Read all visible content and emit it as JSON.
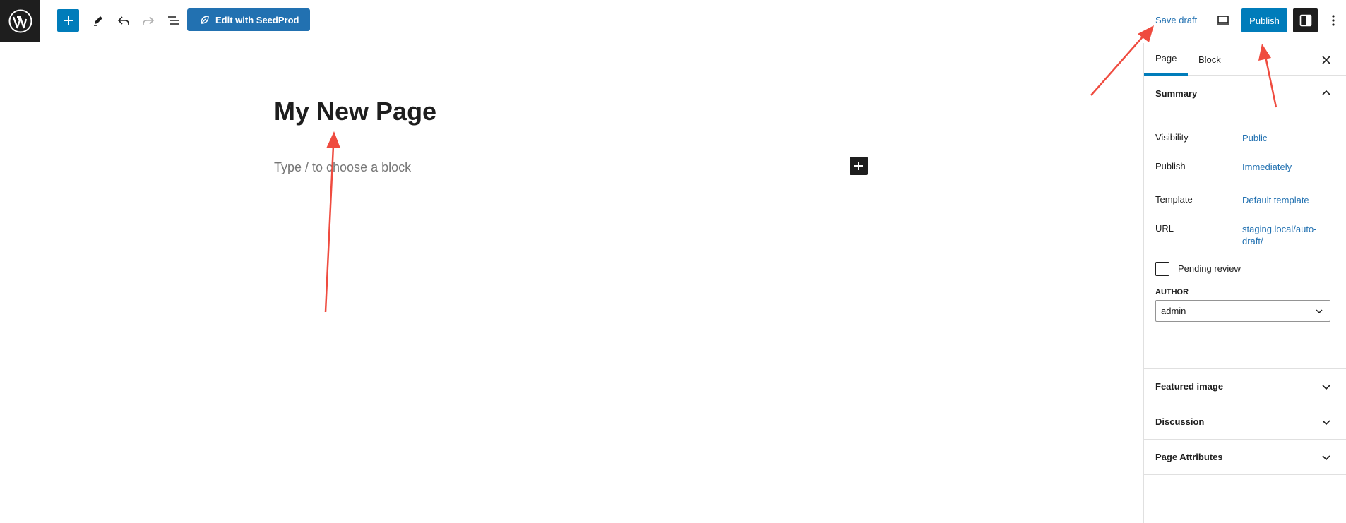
{
  "toolbar": {
    "seedprod_label": "Edit with SeedProd",
    "save_draft_label": "Save draft",
    "publish_label": "Publish"
  },
  "editor": {
    "title": "My New Page",
    "placeholder": "Type / to choose a block"
  },
  "sidebar": {
    "tabs": [
      {
        "label": "Page",
        "active": true
      },
      {
        "label": "Block",
        "active": false
      }
    ],
    "summary": {
      "heading": "Summary",
      "rows": [
        {
          "label": "Visibility",
          "value": "Public"
        },
        {
          "label": "Publish",
          "value": "Immediately"
        },
        {
          "label": "Template",
          "value": "Default template"
        },
        {
          "label": "URL",
          "value": "staging.local/auto-draft/"
        }
      ],
      "pending_review_label": "Pending review",
      "pending_review_checked": false,
      "author_label": "AUTHOR",
      "author_value": "admin"
    },
    "panels": [
      {
        "heading": "Featured image"
      },
      {
        "heading": "Discussion"
      },
      {
        "heading": "Page Attributes"
      }
    ]
  },
  "colors": {
    "accent": "#007cba",
    "link": "#2271b1",
    "dark": "#1e1e1e",
    "annotation_arrow": "#ef4b3f"
  },
  "icons": [
    "wordpress-logo-icon",
    "plus-icon",
    "pencil-icon",
    "undo-icon",
    "redo-icon",
    "list-view-icon",
    "seedprod-leaf-icon",
    "desktop-preview-icon",
    "sidebar-settings-icon",
    "more-vertical-icon",
    "close-icon",
    "chevron-up-icon",
    "chevron-down-icon"
  ]
}
